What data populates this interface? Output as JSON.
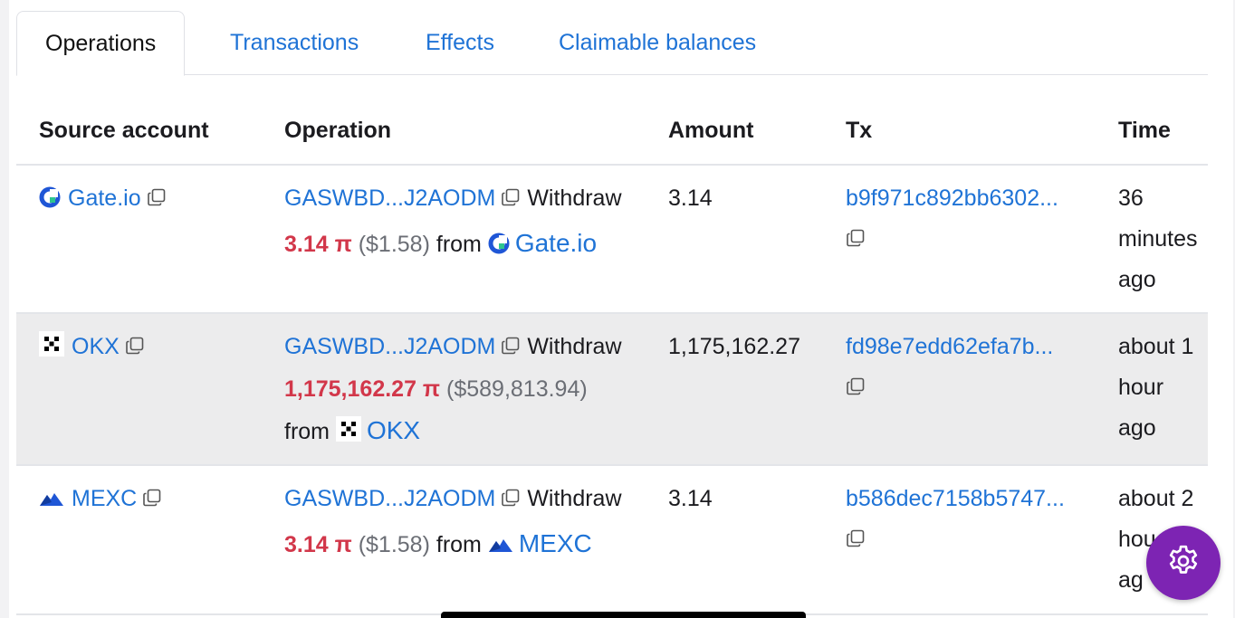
{
  "tabs": [
    {
      "label": "Operations",
      "active": true
    },
    {
      "label": "Transactions",
      "active": false
    },
    {
      "label": "Effects",
      "active": false
    },
    {
      "label": "Claimable balances",
      "active": false
    }
  ],
  "columns": {
    "source": "Source account",
    "operation": "Operation",
    "amount": "Amount",
    "tx": "Tx",
    "time": "Time"
  },
  "rows": [
    {
      "source": "Gate.io",
      "source_icon": "gateio-icon",
      "op_account": "GASWBD...J2AODM",
      "op_type": "Withdraw",
      "op_amount": "3.14 π",
      "op_usd": "($1.58)",
      "op_from": "from",
      "op_from_name": "Gate.io",
      "amount": "3.14",
      "tx": "b9f971c892bb6302...",
      "time_1": "36",
      "time_2": "minutes",
      "time_3": "ago"
    },
    {
      "source": "OKX",
      "source_icon": "okx-icon",
      "op_account": "GASWBD...J2AODM",
      "op_type": "Withdraw",
      "op_amount": "1,175,162.27 π",
      "op_usd": "($589,813.94)",
      "op_from": "from",
      "op_from_name": "OKX",
      "amount": "1,175,162.27",
      "tx": "fd98e7edd62efa7b...",
      "time_1": "about 1",
      "time_2": "hour",
      "time_3": "ago"
    },
    {
      "source": "MEXC",
      "source_icon": "mexc-icon",
      "op_account": "GASWBD...J2AODM",
      "op_type": "Withdraw",
      "op_amount": "3.14 π",
      "op_usd": "($1.58)",
      "op_from": "from",
      "op_from_name": "MEXC",
      "amount": "3.14",
      "tx": "b586dec7158b5747...",
      "time_1": "about 2",
      "time_2": "hou",
      "time_3": "ag"
    }
  ],
  "colors": {
    "link": "#1f73d6",
    "amount_red": "#d2374a",
    "settings_fab": "#7d24b3"
  },
  "settings_icon": "gear-icon"
}
